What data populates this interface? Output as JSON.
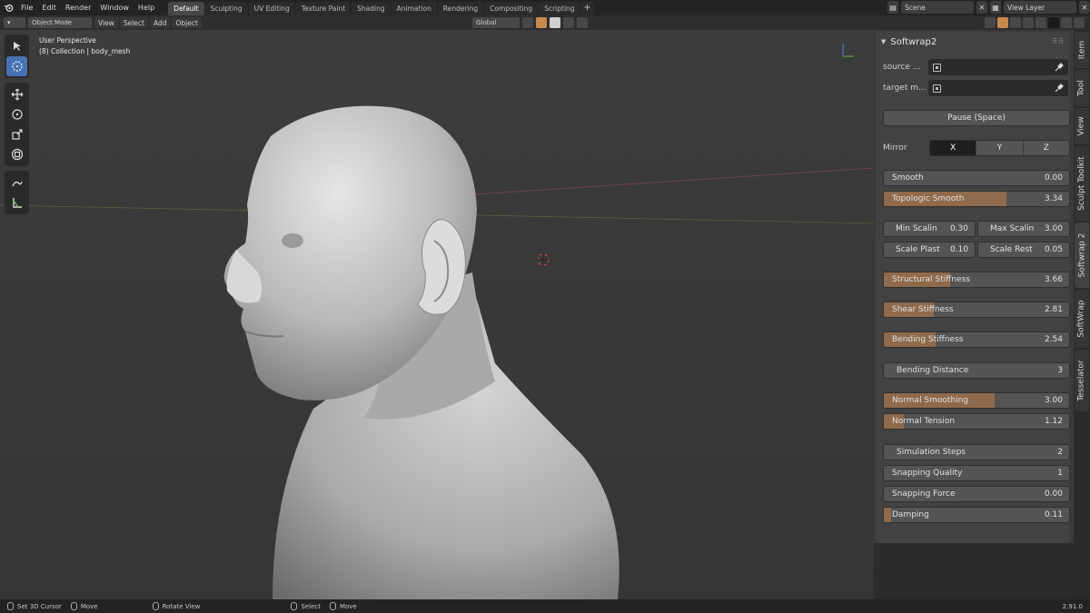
{
  "menu": {
    "items": [
      "File",
      "Edit",
      "Render",
      "Window",
      "Help"
    ]
  },
  "workspaces": {
    "tabs": [
      "Default",
      "Sculpting",
      "UV Editing",
      "Texture Paint",
      "Shading",
      "Animation",
      "Rendering",
      "Compositing",
      "Scripting"
    ],
    "active": "Default",
    "add_label": "+"
  },
  "top_right": {
    "scene": "Scene",
    "view_layer": "View Layer"
  },
  "viewport_header": {
    "mode": "Object Mode",
    "menus": [
      "View",
      "Select",
      "Add",
      "Object"
    ],
    "orientation": "Global"
  },
  "viewport": {
    "title": "User Perspective",
    "subtitle": "(8) Collection | body_mesh"
  },
  "panel": {
    "title": "Softwrap2",
    "source_label": "source ...",
    "target_label": "target m...",
    "pause_label": "Pause (Space)",
    "mirror": {
      "label": "Mirror",
      "options": [
        "X",
        "Y",
        "Z"
      ],
      "selected": "X"
    },
    "sliders": {
      "smooth": {
        "label": "Smooth",
        "value": "0.00",
        "fill": 0
      },
      "topologic_smooth": {
        "label": "Topologic Smooth",
        "value": "3.34",
        "fill": 0.66
      },
      "structural_stiffness": {
        "label": "Structural Stiffness",
        "value": "3.66",
        "fill": 0.36
      },
      "shear_stiffness": {
        "label": "Shear Stiffness",
        "value": "2.81",
        "fill": 0.27
      },
      "bending_stiffness": {
        "label": "Bending Stiffness",
        "value": "2.54",
        "fill": 0.28
      },
      "bending_distance": {
        "label": "Bending Distance",
        "value": "3",
        "fill": 0
      },
      "normal_smoothing": {
        "label": "Normal Smoothing",
        "value": "3.00",
        "fill": 0.6
      },
      "normal_tension": {
        "label": "Normal Tension",
        "value": "1.12",
        "fill": 0.11
      },
      "simulation_steps": {
        "label": "Simulation Steps",
        "value": "2",
        "fill": 0
      },
      "snapping_quality": {
        "label": "Snapping Quality",
        "value": "1",
        "fill": 0
      },
      "snapping_force": {
        "label": "Snapping Force",
        "value": "0.00",
        "fill": 0
      },
      "damping": {
        "label": "Damping",
        "value": "0.11",
        "fill": 0.04
      }
    },
    "min_scalin": {
      "label": "Min Scalin",
      "value": "0.30"
    },
    "max_scalin": {
      "label": "Max Scalin",
      "value": "3.00"
    },
    "scale_plast": {
      "label": "Scale Plast",
      "value": "0.10"
    },
    "scale_rest": {
      "label": "Scale Rest",
      "value": "0.05"
    }
  },
  "side_tabs": [
    "Item",
    "Tool",
    "View",
    "Sculpt Toolkit",
    "Softwrap 2",
    "SoftWrap",
    "Tesselator"
  ],
  "statusbar": {
    "set_cursor": "Set 3D Cursor",
    "move1": "Move",
    "rotate_view": "Rotate View",
    "select": "Select",
    "move2": "Move",
    "version": "2.91.0"
  },
  "colors": {
    "slider_fill": "#8f6a4c",
    "active_tool": "#4772b3",
    "accent_orange": "#c7894c"
  }
}
